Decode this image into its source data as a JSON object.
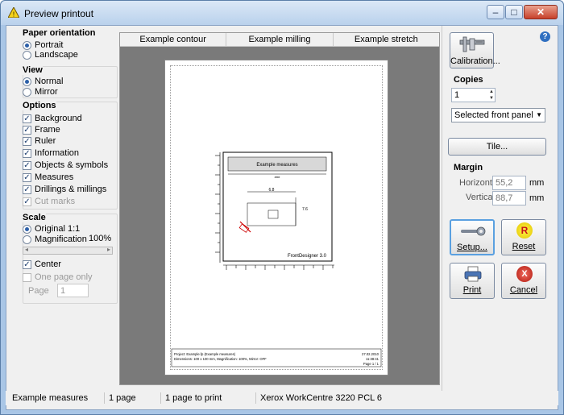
{
  "window": {
    "title": "Preview printout",
    "buttons": {
      "minimize": "–",
      "maximize": "□",
      "close": "✕"
    }
  },
  "left": {
    "orientation": {
      "title": "Paper orientation",
      "portrait": "Portrait",
      "landscape": "Landscape"
    },
    "view": {
      "title": "View",
      "normal": "Normal",
      "mirror": "Mirror"
    },
    "options": {
      "title": "Options",
      "items": [
        "Background",
        "Frame",
        "Ruler",
        "Information",
        "Objects & symbols",
        "Measures",
        "Drillings & millings",
        "Cut marks"
      ]
    },
    "scale": {
      "title": "Scale",
      "original": "Original 1:1",
      "magnification": "Magnification",
      "magnification_value": "100%",
      "center": "Center",
      "one_page_only": "One page only",
      "page_label": "Page",
      "page_value": "1"
    }
  },
  "tabs": [
    "Example contour",
    "Example milling",
    "Example stretch"
  ],
  "sheet": {
    "title": "Example measures",
    "sub": "###",
    "dim_w": "6.8",
    "dim_h": "7.6",
    "brand": "FrontDesigner 3.0",
    "footer_left1": "Project: Example.fp (Example measures)",
    "footer_left2": "Dimensions: 100 x 100 mm, Magnification: 100%, Mirror: OFF",
    "footer_right1": "27.02.2010",
    "footer_right2": "11:38:41",
    "footer_right3": "Page 1 / 1"
  },
  "right": {
    "help": "?",
    "calibration_label": "Calibration...",
    "copies_title": "Copies",
    "copies_value": "1",
    "panel_select": "Selected front panel",
    "tile_label": "Tile...",
    "margin_title": "Margin",
    "horizontal_label": "Horizontal:",
    "horizontal_value": "55,2",
    "vertical_label": "Vertical:",
    "vertical_value": "88,7",
    "unit": "mm",
    "setup_label": "Setup...",
    "reset_label": "Reset",
    "reset_badge": "R",
    "print_label": "Print",
    "cancel_label": "Cancel",
    "cancel_badge": "X"
  },
  "status": {
    "name": "Example measures",
    "pages": "1 page",
    "to_print": "1 page to print",
    "printer": "Xerox WorkCentre 3220 PCL 6"
  }
}
